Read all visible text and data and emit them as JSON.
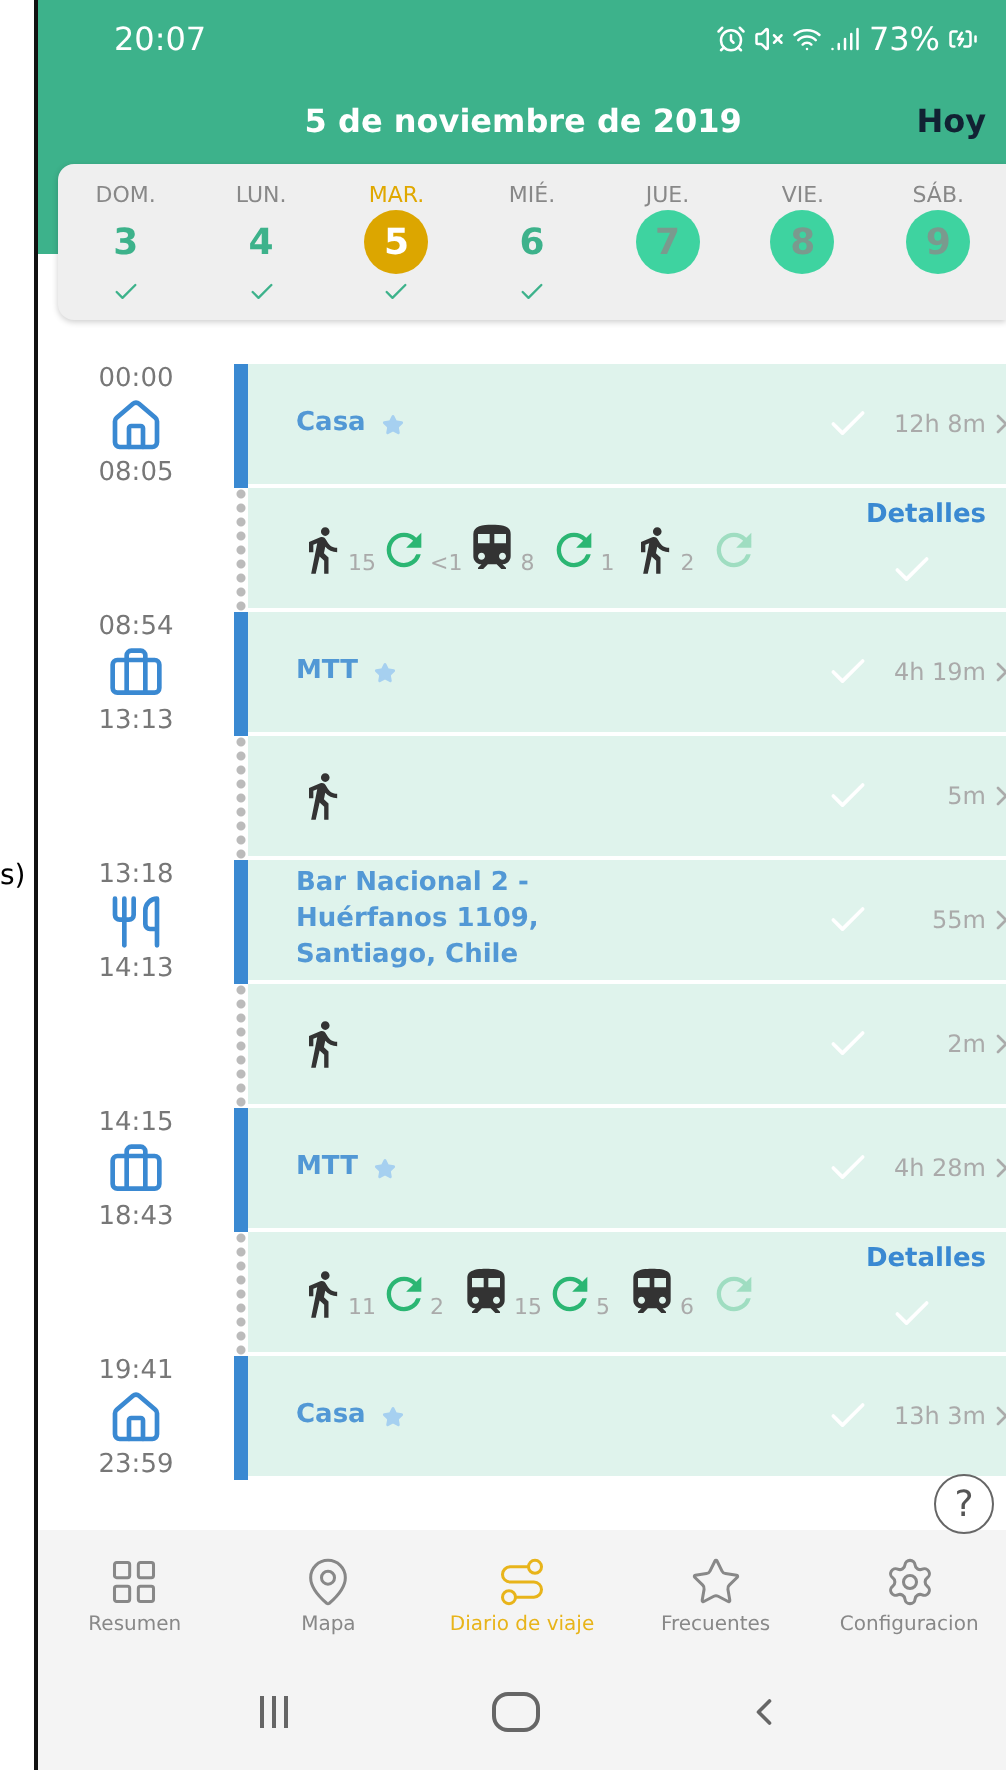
{
  "margin_text": "s)",
  "status_bar": {
    "time": "20:07",
    "battery": "73%"
  },
  "header": {
    "title": "5 de noviembre de 2019",
    "today_button": "Hoy"
  },
  "week": [
    {
      "label": "DOM.",
      "number": "3",
      "selected": false,
      "filled": false,
      "checked": true
    },
    {
      "label": "LUN.",
      "number": "4",
      "selected": false,
      "filled": false,
      "checked": true
    },
    {
      "label": "MAR.",
      "number": "5",
      "selected": true,
      "filled": false,
      "checked": true
    },
    {
      "label": "MIÉ.",
      "number": "6",
      "selected": false,
      "filled": false,
      "checked": true
    },
    {
      "label": "JUE.",
      "number": "7",
      "selected": false,
      "filled": true,
      "checked": false
    },
    {
      "label": "VIE.",
      "number": "8",
      "selected": false,
      "filled": true,
      "checked": false
    },
    {
      "label": "SÁB.",
      "number": "9",
      "selected": false,
      "filled": true,
      "checked": false
    }
  ],
  "timeline": [
    {
      "kind": "home",
      "start": "00:00",
      "end": "08:05",
      "name": "Casa",
      "starred": true,
      "duration": "12h 8m"
    },
    {
      "kind": "trip",
      "details": "Detalles",
      "segments": [
        {
          "kind": "walk",
          "count": "15",
          "partial": false
        },
        {
          "kind": "wait",
          "count": "<1",
          "partial": false
        },
        {
          "kind": "train",
          "count": "8",
          "partial": false
        },
        {
          "kind": "wait",
          "count": "1",
          "partial": false
        },
        {
          "kind": "walk",
          "count": "2",
          "partial": false
        },
        {
          "kind": "wait",
          "partial": true
        }
      ]
    },
    {
      "kind": "work",
      "start": "08:54",
      "end": "13:13",
      "name": "MTT",
      "starred": true,
      "duration": "4h 19m"
    },
    {
      "kind": "trip",
      "duration": "5m",
      "segments": [
        {
          "kind": "walk",
          "partial": false
        }
      ]
    },
    {
      "kind": "food",
      "start": "13:18",
      "end": "14:13",
      "name": "Bar Nacional 2 - Huérfanos 1109, Santiago, Chile",
      "starred": false,
      "duration": "55m"
    },
    {
      "kind": "trip",
      "duration": "2m",
      "segments": [
        {
          "kind": "walk",
          "partial": false
        }
      ]
    },
    {
      "kind": "work",
      "start": "14:15",
      "end": "18:43",
      "name": "MTT",
      "starred": true,
      "duration": "4h 28m"
    },
    {
      "kind": "trip",
      "details": "Detalles",
      "segments": [
        {
          "kind": "walk",
          "count": "11",
          "partial": false
        },
        {
          "kind": "wait",
          "count": "2",
          "partial": false
        },
        {
          "kind": "train",
          "count": "15",
          "partial": false
        },
        {
          "kind": "wait",
          "count": "5",
          "partial": false
        },
        {
          "kind": "train",
          "count": "6",
          "partial": false
        },
        {
          "kind": "wait",
          "partial": true
        }
      ]
    },
    {
      "kind": "home",
      "start": "19:41",
      "end": "23:59",
      "name": "Casa",
      "starred": true,
      "duration": "13h 3m"
    }
  ],
  "help_button": "?",
  "bottom_nav": [
    {
      "label": "Resumen",
      "selected": false
    },
    {
      "label": "Mapa",
      "selected": false
    },
    {
      "label": "Diario de viaje",
      "selected": true
    },
    {
      "label": "Frecuentes",
      "selected": false
    },
    {
      "label": "Configuracion",
      "selected": false
    }
  ]
}
